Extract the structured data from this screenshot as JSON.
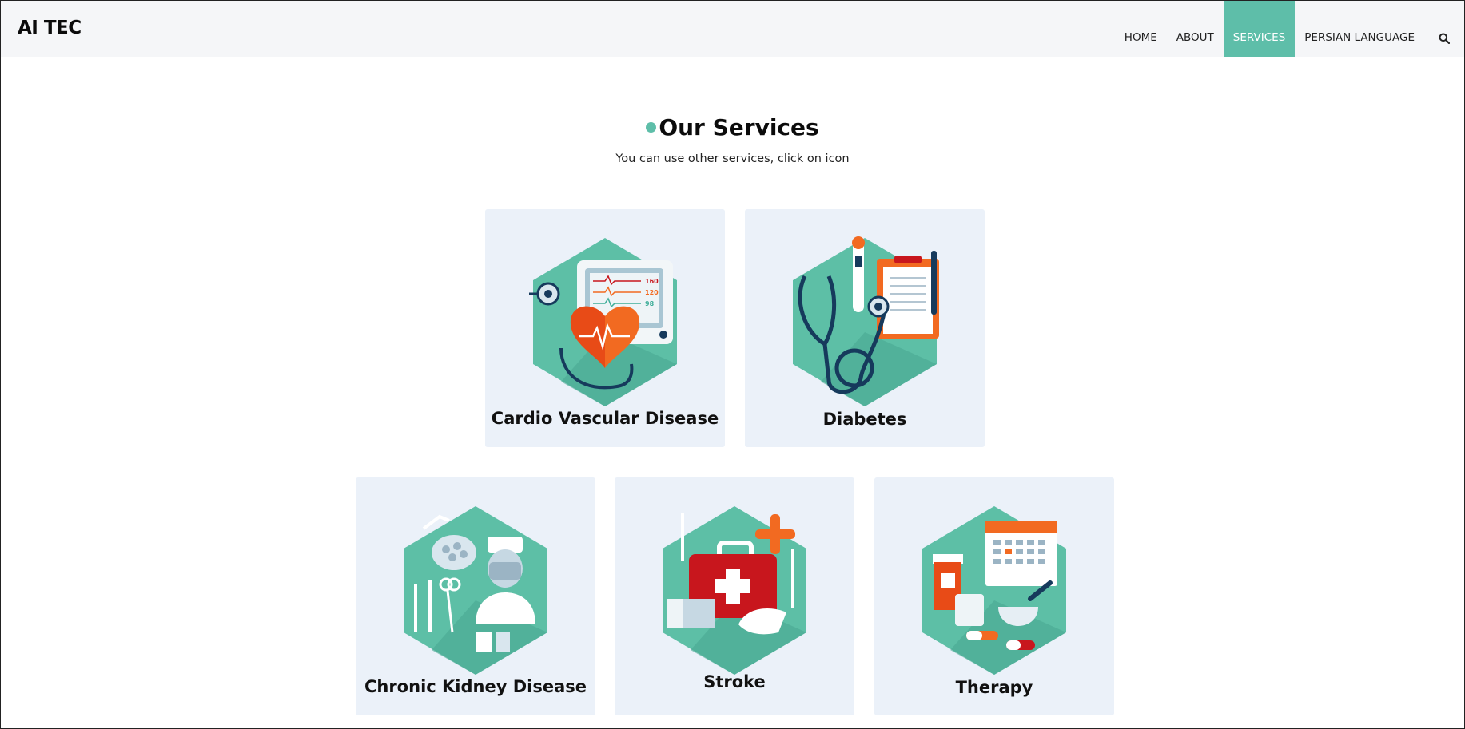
{
  "brand": "AI TEC",
  "nav": {
    "items": [
      {
        "label": "HOME",
        "active": false
      },
      {
        "label": "ABOUT",
        "active": false
      },
      {
        "label": "SERVICES",
        "active": true
      },
      {
        "label": "PERSIAN LANGUAGE",
        "active": false
      }
    ],
    "search_icon": "search-icon"
  },
  "section": {
    "title": "Our Services",
    "subtitle": "You can use other services, click on icon"
  },
  "services": [
    {
      "label": "Cardio Vascular Disease",
      "icon": "cardio-monitor-heart-icon"
    },
    {
      "label": "Diabetes",
      "icon": "stethoscope-clipboard-icon"
    },
    {
      "label": "Chronic Kidney Disease",
      "icon": "surgeon-instruments-icon"
    },
    {
      "label": "Stroke",
      "icon": "first-aid-kit-icon"
    },
    {
      "label": "Therapy",
      "icon": "pills-calendar-icon"
    }
  ],
  "colors": {
    "accent": "#5ebea9",
    "card_bg": "#ebf1f9",
    "hex_green": "#5dbfa6",
    "orange": "#f26a21",
    "navy": "#163a5c",
    "red": "#c8161d"
  }
}
